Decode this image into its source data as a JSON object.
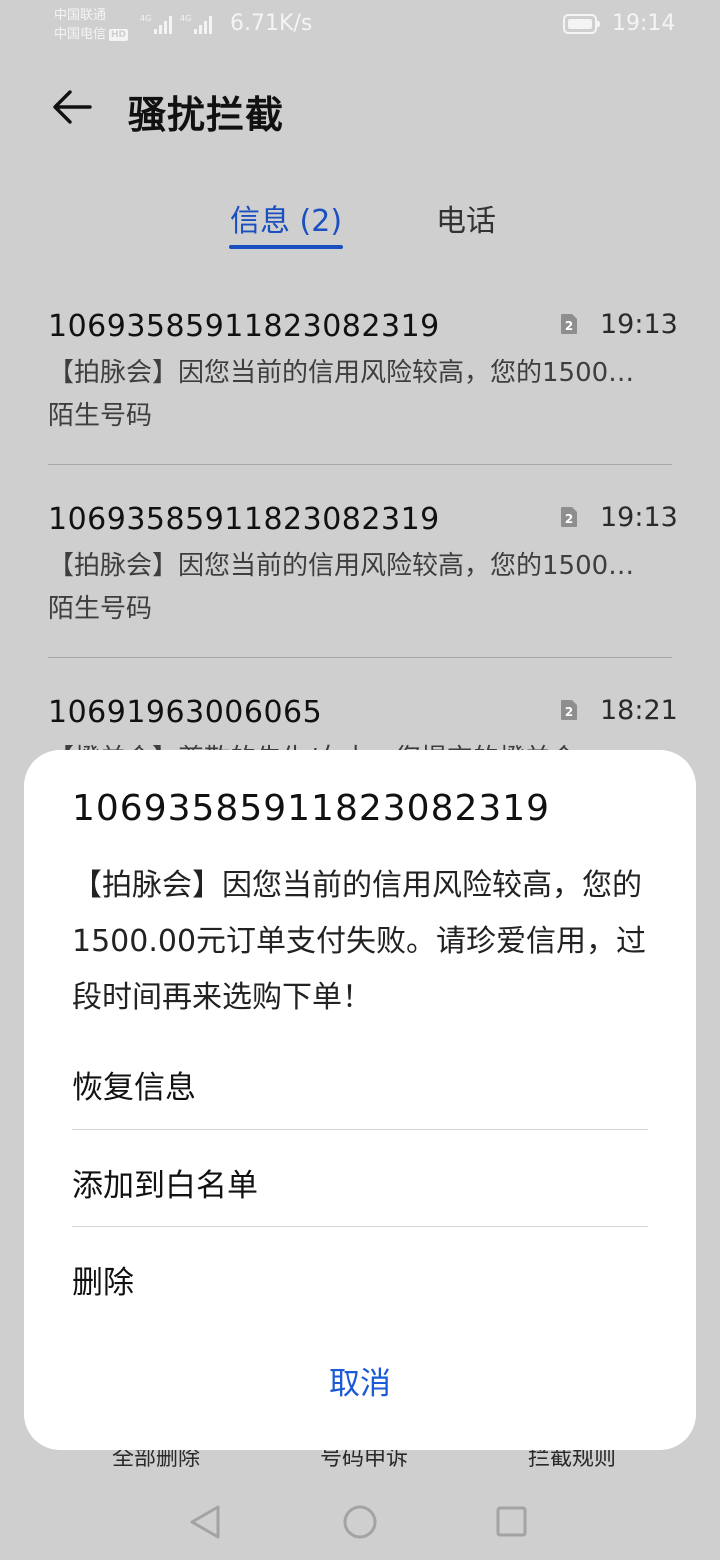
{
  "status_bar": {
    "carrier1": "中国联通",
    "carrier2": "中国电信",
    "hd_badge": "HD",
    "net1": "4G",
    "net2": "4G",
    "speed": "6.71K/s",
    "time": "19:14",
    "battery_icon": "battery-icon"
  },
  "header": {
    "back_icon": "arrow-left-icon",
    "title": "骚扰拦截"
  },
  "tabs": [
    {
      "label": "信息 (2)",
      "active": true
    },
    {
      "label": "电话",
      "active": false
    }
  ],
  "messages": [
    {
      "number": "10693585911823082319",
      "time": "19:13",
      "sim": "2",
      "preview": "【拍脉会】因您当前的信用风险较高，您的1500…",
      "tag": "陌生号码"
    },
    {
      "number": "10693585911823082319",
      "time": "19:13",
      "sim": "2",
      "preview": "【拍脉会】因您当前的信用风险较高，您的1500…",
      "tag": "陌生号码"
    },
    {
      "number": "10691963006065",
      "time": "18:21",
      "sim": "2",
      "preview": "【橙羊会】尊敬的先生/女士，您提交的橙羊会",
      "tag": ""
    }
  ],
  "bottom_bar": {
    "delete_all": "全部删除",
    "appeal": "号码申诉",
    "rules": "拦截规则"
  },
  "sheet": {
    "number": "10693585911823082319",
    "body": "【拍脉会】因您当前的信用风险较高，您的1500.00元订单支付失败。请珍爱信用，过段时间再来选购下单！",
    "options": [
      "恢复信息",
      "添加到白名单",
      "删除"
    ],
    "cancel": "取消"
  },
  "colors": {
    "accent": "#1a4fbf",
    "cancel": "#1a5ad6",
    "background": "#cfcfcf",
    "sheet": "#ffffff"
  }
}
